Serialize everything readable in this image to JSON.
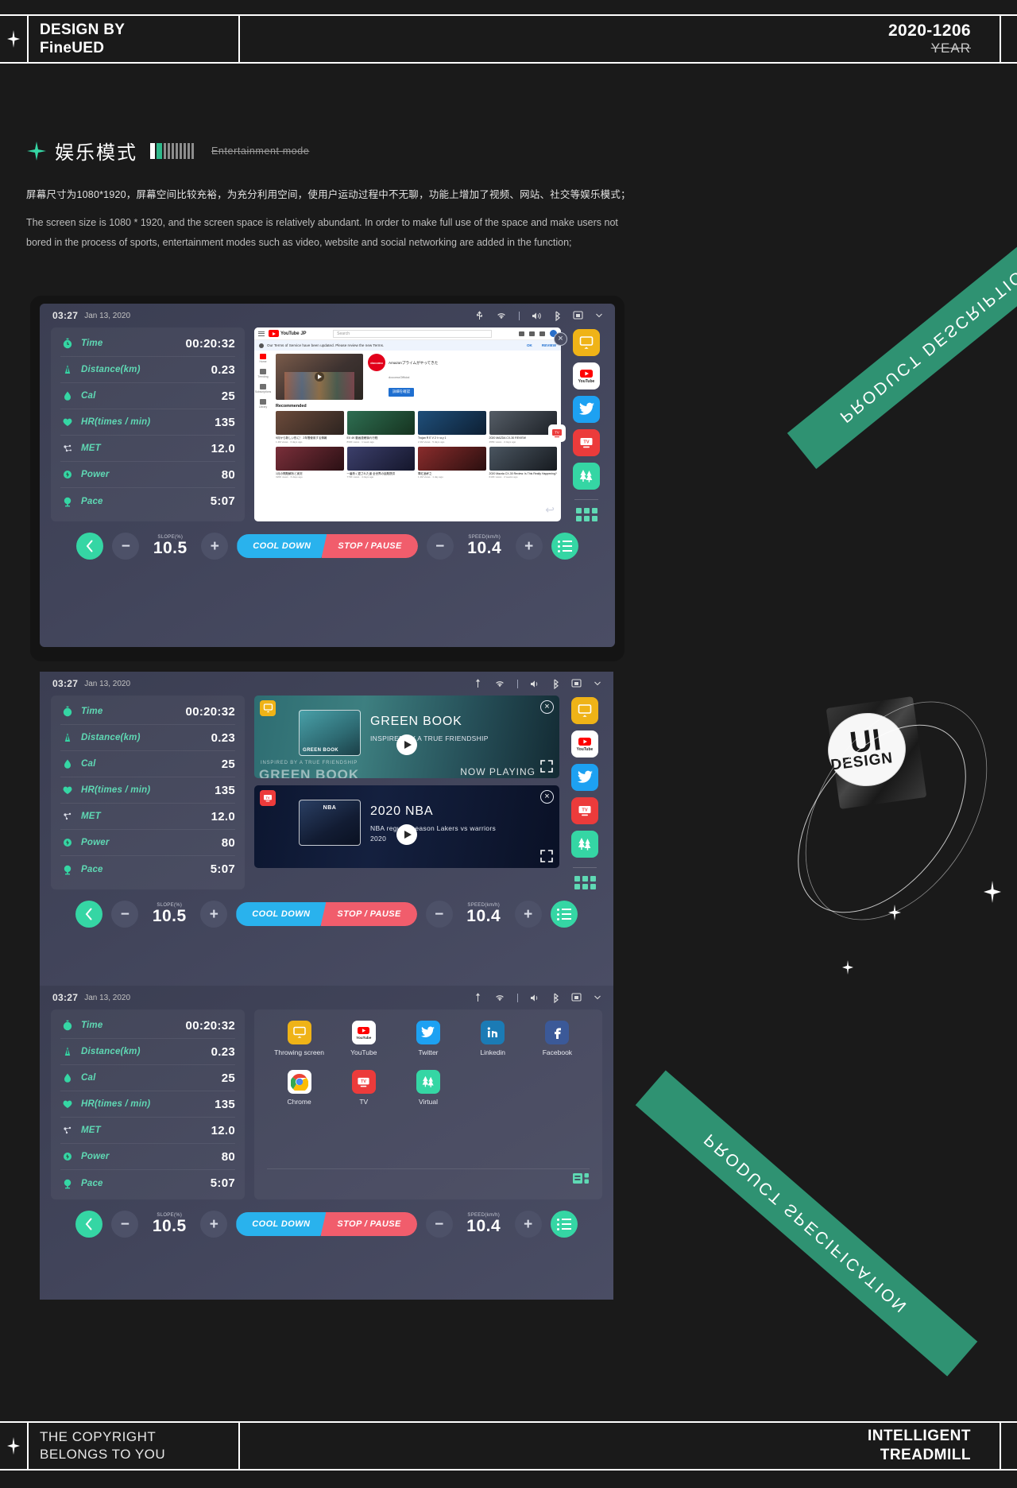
{
  "header": {
    "design_by_line1": "DESIGN BY",
    "design_by_line2": "FineUED",
    "date": "2020-1206",
    "year_label": "YEAR",
    "spark_icon": "sparkle-icon"
  },
  "section": {
    "icon": "sparkle-icon",
    "title_cn": "娱乐模式",
    "title_en": "Entertainment mode"
  },
  "description": {
    "cn": "屏幕尺寸为1080*1920，屏幕空间比较充裕，为充分利用空间，使用户运动过程中不无聊，功能上增加了视频、网站、社交等娱乐模式；",
    "en": "The screen size is 1080 * 1920, and the screen space is relatively abundant. In order to make full use of the space and make users not bored in the process of sports, entertainment modes such as video, website and social networking are added in the function;"
  },
  "status_bar": {
    "time": "03:27",
    "date": "Jan 13, 2020",
    "icons": [
      "usb-icon",
      "wifi-icon",
      "volume-icon",
      "bluetooth-icon",
      "cast-icon",
      "chevron-down-icon"
    ]
  },
  "metrics": [
    {
      "icon": "stopwatch-icon",
      "label": "Time",
      "value": "00:20:32"
    },
    {
      "icon": "distance-icon",
      "label": "Distance(km)",
      "value": "0.23"
    },
    {
      "icon": "flame-icon",
      "label": "Cal",
      "value": "25"
    },
    {
      "icon": "heart-icon",
      "label": "HR(times / min)",
      "value": "135"
    },
    {
      "icon": "molecule-icon",
      "label": "MET",
      "value": "12.0"
    },
    {
      "icon": "power-icon",
      "label": "Power",
      "value": "80"
    },
    {
      "icon": "pace-icon",
      "label": "Pace",
      "value": "5:07"
    }
  ],
  "controls": {
    "back_icon": "chevron-left-icon",
    "minus": "−",
    "plus": "+",
    "slope_caption": "SLOPE(%)",
    "slope_value": "10.5",
    "cool_down": "COOL DOWN",
    "stop_pause": "STOP / PAUSE",
    "speed_caption": "SPEED(km/h)",
    "speed_value": "10.4",
    "menu_icon": "list-menu-icon",
    "cool_color": "#29b2ed",
    "stop_color": "#f15d6c",
    "accent_color": "#35d6a4"
  },
  "app_rail": [
    {
      "icon": "throwing-screen-icon",
      "name": "Throwing screen",
      "color": "#efb317"
    },
    {
      "icon": "youtube-icon",
      "name": "YouTube",
      "color": "#ffffff"
    },
    {
      "icon": "twitter-icon",
      "name": "Twitter",
      "color": "#1da1f2"
    },
    {
      "icon": "tv-icon",
      "name": "TV",
      "color": "#ec3b3b"
    },
    {
      "icon": "virtual-icon",
      "name": "Virtual",
      "color": "#35d6a4"
    },
    {
      "icon": "grid-apps-icon",
      "name": "All apps",
      "color": "#5fd9b4"
    }
  ],
  "browser": {
    "hamburger_icon": "hamburger-icon",
    "logo_text": "YouTube",
    "country_code": "JP",
    "search_placeholder": "Search",
    "search_icon": "search-icon",
    "header_icons": [
      "video-upload-icon",
      "apps-grid-icon",
      "bell-icon",
      "avatar"
    ],
    "banner_text": "Our Terms of Service have been updated. Please review the new Terms.",
    "banner_ok": "OK",
    "banner_review": "REVIEW",
    "sidebar": [
      {
        "icon": "home-icon",
        "label": "Home"
      },
      {
        "icon": "trending-icon",
        "label": "Trending"
      },
      {
        "icon": "subscriptions-icon",
        "label": "Subscriptions"
      },
      {
        "icon": "library-icon",
        "label": "Library"
      }
    ],
    "featured": {
      "channel": "docomo",
      "title": "Amazonプライムがやってきた",
      "subtitle": "docomoOfficial",
      "button": "詳細を確認"
    },
    "recommended_heading": "Recommended",
    "recommended": [
      {
        "title": "9月から新しい形に！ 2年間使用する情報",
        "sub": "1.2M views · 3 days ago"
      },
      {
        "title": "EX 4K 動画投稿後れ行程",
        "sub": "890K views · 1 week ago"
      },
      {
        "title": "Trojan R E V 2 t r a y 1",
        "sub": "2.1M views · 5 days ago"
      },
      {
        "title": "2020 MAZDA CX-30 REVIEW",
        "sub": "455K views · 2 days ago"
      },
      {
        "title": "1月の問題解析と実況",
        "sub": "320K views · 6 days ago"
      },
      {
        "title": "一番熱く愛された道 全世界の話題提供",
        "sub": "770K views · 4 days ago"
      },
      {
        "title": "翠红酒杯之",
        "sub": "1.1M views · 1 day ago"
      },
      {
        "title": "2020 Mazda CX-30 Review: Is This Really Happening?",
        "sub": "610K views · 2 weeks ago"
      }
    ],
    "close_icon": "close-icon",
    "undo_icon": "undo-icon",
    "float_app_icon": "tv-icon"
  },
  "videos": [
    {
      "badge_icon": "throwing-screen-icon",
      "badge_color": "#efb317",
      "title": "GREEN BOOK",
      "subtitle": "INSPIRED BY A TRUE FRIENDSHIP",
      "poster_caption": "GREEN BOOK",
      "overlay_text": "NOW PLAYING",
      "footer_text": "INSPIRED BY A TRUE FRIENDSHIP",
      "big_text": "GREEN BOOK",
      "play_icon": "play-icon",
      "close_icon": "close-icon",
      "fullscreen_icon": "fullscreen-icon"
    },
    {
      "badge_icon": "tv-icon",
      "badge_color": "#ec3b3b",
      "title": "2020 NBA",
      "subtitle": "NBA regular season Lakers vs warriors 2020",
      "poster_caption": "NBA",
      "overlay_text": "",
      "footer_text": "",
      "big_text": "",
      "play_icon": "play-icon",
      "close_icon": "close-icon",
      "fullscreen_icon": "fullscreen-icon"
    }
  ],
  "app_grid": [
    {
      "icon": "throwing-screen-icon",
      "label": "Throwing screen",
      "color": "#efb317"
    },
    {
      "icon": "youtube-icon",
      "label": "YouTube",
      "color": "#ffffff"
    },
    {
      "icon": "twitter-icon",
      "label": "Twitter",
      "color": "#1da1f2"
    },
    {
      "icon": "linkedin-icon",
      "label": "Linkedin",
      "color": "#1b7bb5"
    },
    {
      "icon": "facebook-icon",
      "label": "Facebook",
      "color": "#3b5998"
    },
    {
      "icon": "chrome-icon",
      "label": "Chrome",
      "color": "#ffffff"
    },
    {
      "icon": "tv-icon",
      "label": "TV",
      "color": "#ec3b3b"
    },
    {
      "icon": "virtual-icon",
      "label": "Virtual",
      "color": "#35d6a4"
    }
  ],
  "app_grid_footer_icon": "layout-view-icon",
  "decor": {
    "ribbon_1": "PRODUCT DESCRIPTION",
    "ribbon_2": "PRODUCT SPECIFICATION",
    "badge_line1": "UI",
    "badge_line2": "DESIGN",
    "ribbon_color": "#2f9272"
  },
  "footer": {
    "copy_line1": "THE COPYRIGHT",
    "copy_line2": "BELONGS TO YOU",
    "title_line1": "INTELLIGENT",
    "title_line2": "TREADMILL",
    "spark_icon": "sparkle-icon"
  }
}
